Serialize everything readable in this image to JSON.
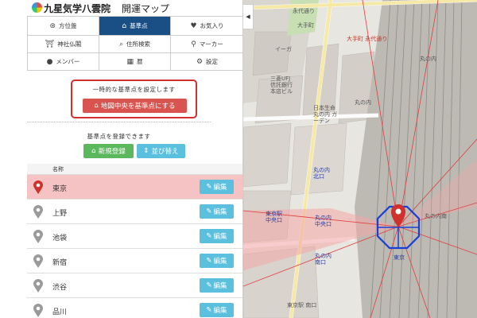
{
  "header": {
    "brand": "九星気学八雲院",
    "app_title": "開運マップ"
  },
  "menu": [
    {
      "label": "方位盤",
      "icon": "compass-icon",
      "glyph": "⊛"
    },
    {
      "label": "基準点",
      "icon": "home-icon",
      "glyph": "⌂"
    },
    {
      "label": "お気入り",
      "icon": "heart-icon",
      "glyph": "♥"
    },
    {
      "label": "神社仏閣",
      "icon": "torii-icon",
      "glyph": "⛩"
    },
    {
      "label": "住所検索",
      "icon": "search-icon",
      "glyph": "⌕"
    },
    {
      "label": "マーカー",
      "icon": "marker-icon",
      "glyph": "⚲"
    },
    {
      "label": "メンバー",
      "icon": "user-icon",
      "glyph": "●"
    },
    {
      "label": "暦",
      "icon": "calendar-icon",
      "glyph": "▦"
    },
    {
      "label": "設定",
      "icon": "gear-icon",
      "glyph": "⚙"
    }
  ],
  "temporary": {
    "text": "一時的な基準点を設定します",
    "button": "地図中央を基準点にする"
  },
  "register": {
    "text": "基準点を登録できます",
    "new_button": "新規登録",
    "sort_button": "並び替え"
  },
  "list": {
    "column_name": "名称",
    "edit_label": "編集",
    "rows": [
      {
        "name": "東京",
        "selected": true
      },
      {
        "name": "上野",
        "selected": false
      },
      {
        "name": "池袋",
        "selected": false
      },
      {
        "name": "新宿",
        "selected": false
      },
      {
        "name": "渋谷",
        "selected": false
      },
      {
        "name": "品川",
        "selected": false
      }
    ]
  },
  "map": {
    "collapse_glyph": "◀",
    "labels": {
      "eitai": "永代通り",
      "otemachi": "大手町",
      "otemachi_eki": "大手町 永代通り",
      "ishii": "イーガ",
      "mitsubishi": "三菱UFJ 信託銀行 本店ビル",
      "nihon": "日本生命 丸の内 ガーデン",
      "tokyo_st": "東京駅",
      "marunouchi_n": "丸の内 北口",
      "marunouchi_c": "丸の内 中央口",
      "marunouchi_s": "丸の内 南口",
      "marunouchi": "丸の内",
      "tokyo_c": "東京駅 中央口",
      "tokyo_s": "東京駅 南口",
      "marunouchi2": "丸の内",
      "tokyo_st2": "東京",
      "marunouchi_a": "丸の内南"
    }
  },
  "colors": {
    "active_menu": "#1a4f86",
    "danger": "#d9534f",
    "success": "#5cb85c",
    "info": "#5bc0de",
    "selected_row": "#f5c3c3"
  }
}
